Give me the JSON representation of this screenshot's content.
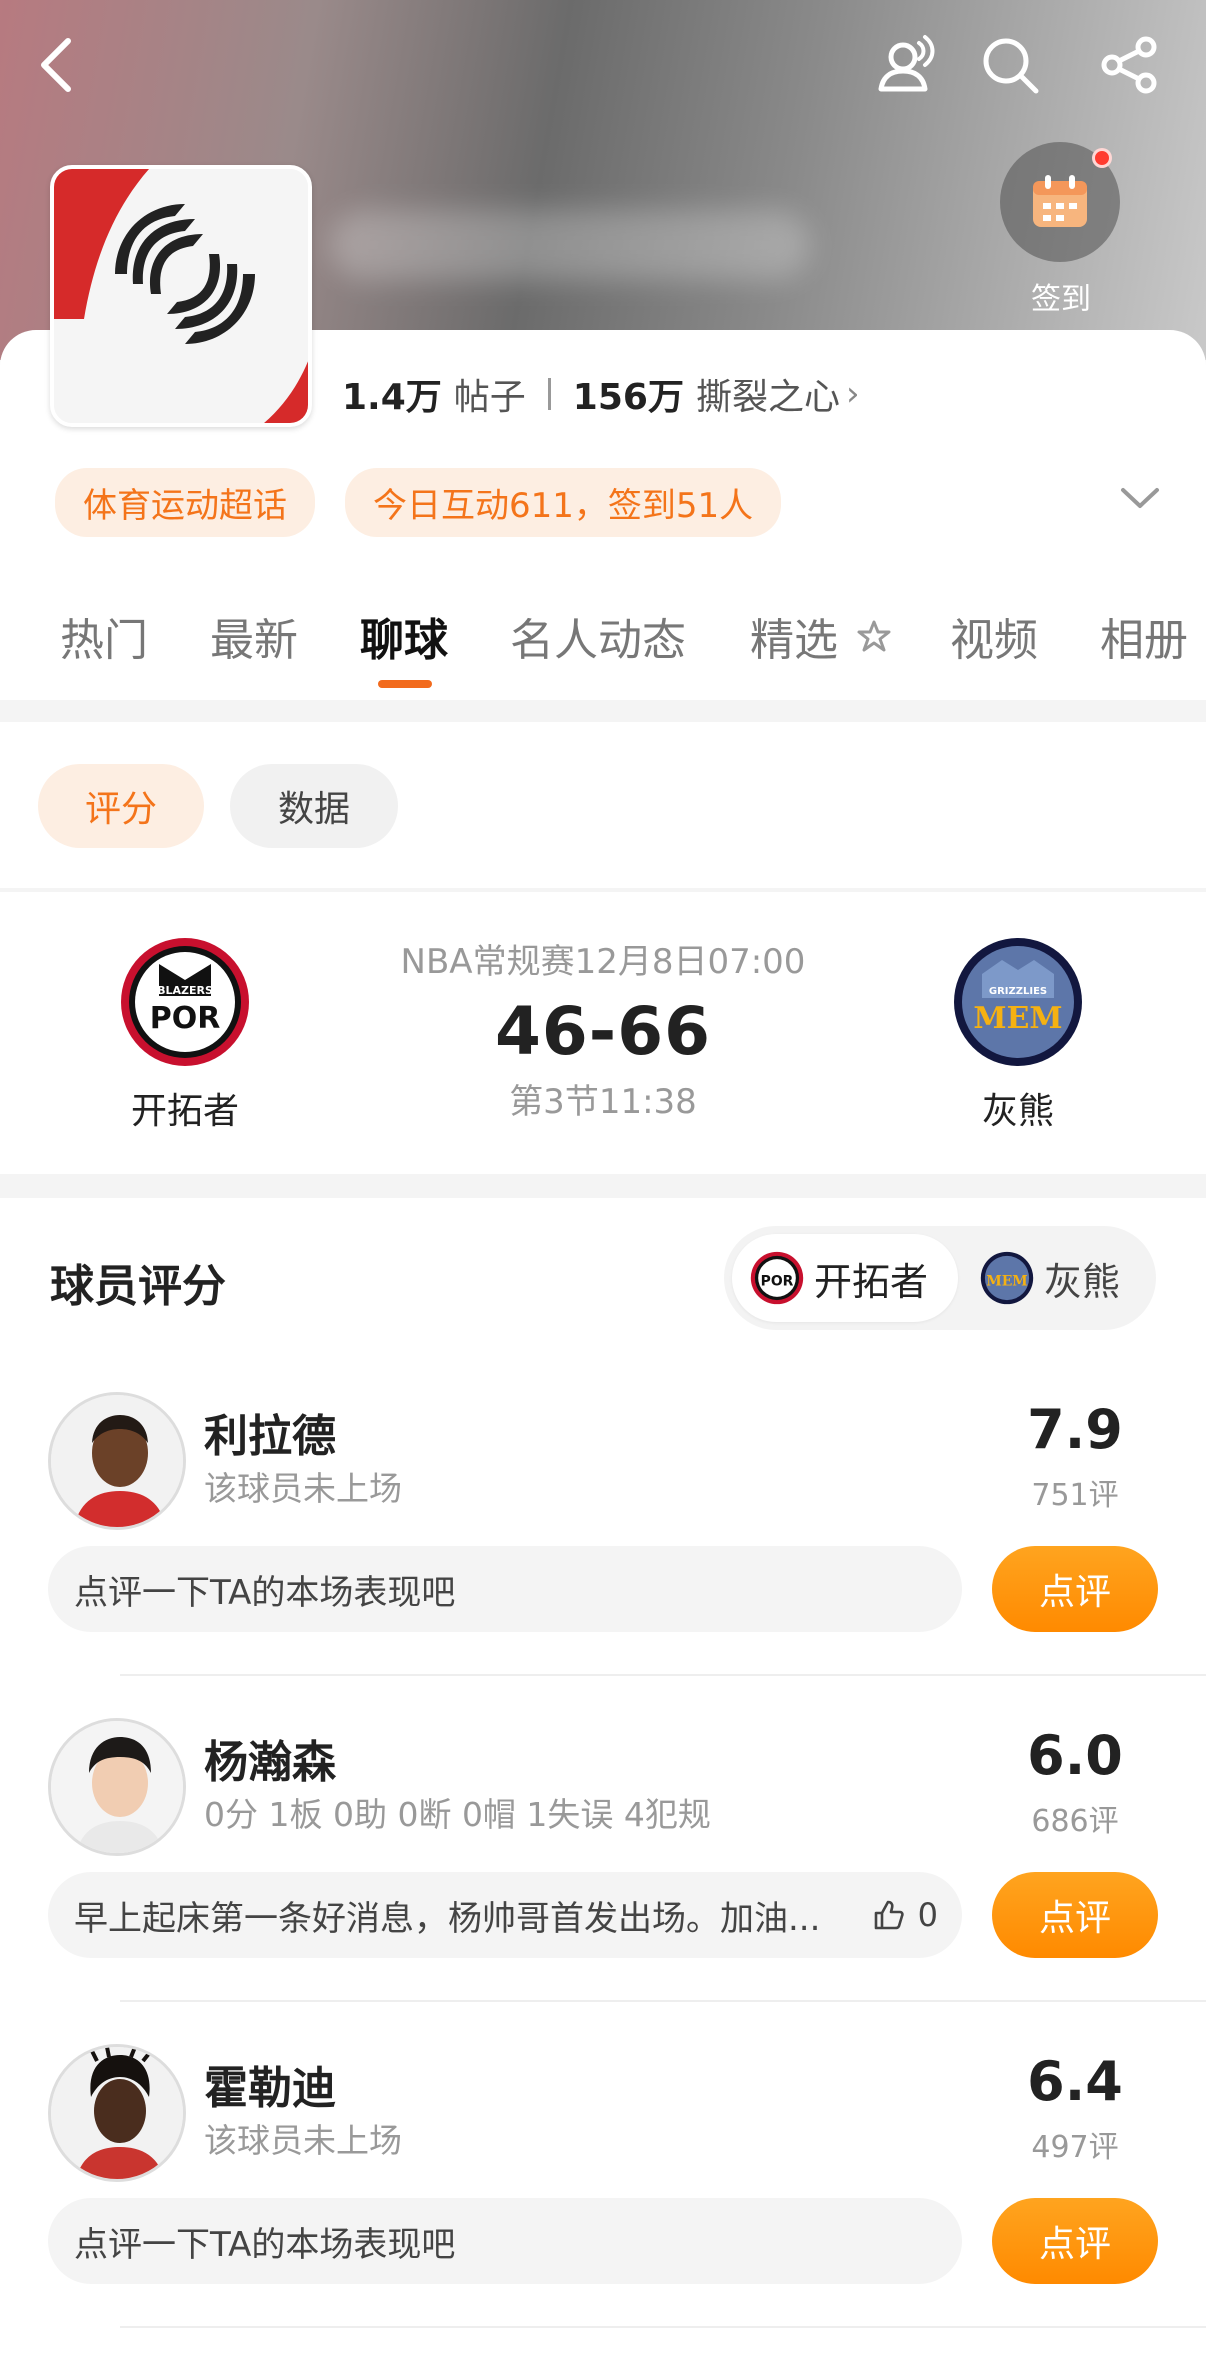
{
  "header": {
    "signin_label": "签到",
    "stats": {
      "posts_value": "1.4万",
      "posts_label": "帖子",
      "fans_value": "156万",
      "fans_label": "撕裂之心"
    },
    "tags": [
      "体育运动超话",
      "今日互动611，签到51人"
    ],
    "colors": {
      "accent": "#f26b1d",
      "tag_bg": "#fdeee2"
    }
  },
  "tabs": [
    {
      "label": "热门",
      "active": false
    },
    {
      "label": "最新",
      "active": false
    },
    {
      "label": "聊球",
      "active": true
    },
    {
      "label": "名人动态",
      "active": false
    },
    {
      "label": "精选",
      "active": false
    },
    {
      "label": "视频",
      "active": false
    },
    {
      "label": "相册",
      "active": false
    }
  ],
  "filters": {
    "rating": "评分",
    "data": "数据"
  },
  "match": {
    "meta": "NBA常规赛12月8日07:00",
    "score": "46-66",
    "period": "第3节11:38",
    "home": {
      "name": "开拓者",
      "logo_text": "POR",
      "logo_sub": "BLAZERS",
      "color": "#c8102e"
    },
    "away": {
      "name": "灰熊",
      "logo_text": "MEM",
      "logo_sub": "GRIZZLIES",
      "color": "#5d76a9"
    }
  },
  "ratings": {
    "title": "球员评分",
    "switch": {
      "home": "开拓者",
      "away": "灰熊"
    },
    "rate_button": "点评",
    "players": [
      {
        "name": "利拉德",
        "sub": "该球员未上场",
        "score": "7.9",
        "count": "751评",
        "comment": "点评一下TA的本场表现吧",
        "likes": null
      },
      {
        "name": "杨瀚森",
        "sub": "0分 1板 0助 0断 0帽 1失误 4犯规",
        "score": "6.0",
        "count": "686评",
        "comment": "早上起床第一条好消息，杨帅哥首发出场。加油...",
        "likes": "0"
      },
      {
        "name": "霍勒迪",
        "sub": "该球员未上场",
        "score": "6.4",
        "count": "497评",
        "comment": "点评一下TA的本场表现吧",
        "likes": null
      }
    ]
  },
  "icons": [
    "back-icon",
    "user-mention-icon",
    "search-icon",
    "share-icon",
    "calendar-icon",
    "chevron-down-icon",
    "chevron-right-icon",
    "thumbs-up-icon"
  ]
}
